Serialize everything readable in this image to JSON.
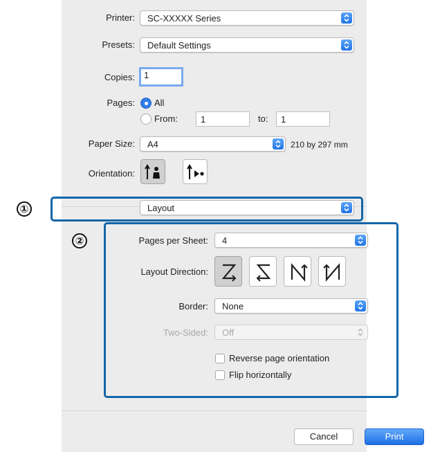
{
  "printer": {
    "label": "Printer:",
    "value": "SC-XXXXX Series"
  },
  "presets": {
    "label": "Presets:",
    "value": "Default Settings"
  },
  "copies": {
    "label": "Copies:",
    "value": "1"
  },
  "pages": {
    "label": "Pages:",
    "all_label": "All",
    "from_label": "From:",
    "from_value": "1",
    "to_label": "to:",
    "to_value": "1",
    "selected": "All"
  },
  "paper_size": {
    "label": "Paper Size:",
    "value": "A4",
    "dimensions": "210 by 297 mm"
  },
  "orientation": {
    "label": "Orientation:",
    "options": [
      "portrait-icon",
      "landscape-icon"
    ],
    "selected": "portrait"
  },
  "section": {
    "value": "Layout"
  },
  "layout": {
    "pages_per_sheet": {
      "label": "Pages per Sheet:",
      "value": "4"
    },
    "layout_direction": {
      "label": "Layout Direction:",
      "options": [
        "z-order-icon",
        "reverse-z-order-icon",
        "n-order-icon",
        "reverse-n-order-icon"
      ],
      "selected_index": 0
    },
    "border": {
      "label": "Border:",
      "value": "None"
    },
    "two_sided": {
      "label": "Two-Sided:",
      "value": "Off"
    },
    "reverse_orientation": {
      "label": "Reverse page orientation",
      "checked": false
    },
    "flip_horizontally": {
      "label": "Flip horizontally",
      "checked": false
    }
  },
  "callouts": [
    "①",
    "②"
  ],
  "buttons": {
    "cancel": "Cancel",
    "print": "Print"
  },
  "colors": {
    "accent": "#2f7de8",
    "callout": "#1265a8",
    "panel": "#ececec"
  }
}
